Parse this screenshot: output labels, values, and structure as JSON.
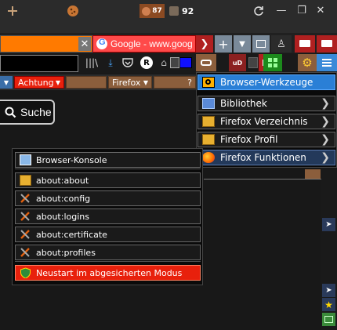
{
  "titlebar": {
    "counter_a": "87",
    "counter_b": "92",
    "icons": [
      "plus-icon",
      "cookie-icon",
      "monkey-icon",
      "puzzle-icon",
      "refresh-icon"
    ]
  },
  "window_controls": {
    "minimize": "—",
    "restore": "❐",
    "close": "✕"
  },
  "tabs": [
    {
      "label": ""
    },
    {
      "label": "Google - www.goog"
    }
  ],
  "tab_close": "✕",
  "bookmarks": [
    {
      "label": "Achtung"
    },
    {
      "label": "Firefox"
    },
    {
      "label": "?"
    }
  ],
  "search_button": {
    "label": "Suche"
  },
  "main_menu": {
    "header": "Browser-Werkzeuge",
    "items": [
      {
        "label": "Bibliothek",
        "arrow": "❯"
      },
      {
        "label": "Firefox Verzeichnis",
        "arrow": "❯"
      },
      {
        "label": "Firefox Profil",
        "arrow": "❯"
      },
      {
        "label": "Firefox Funktionen",
        "arrow": "❯"
      }
    ]
  },
  "submenu": {
    "items": [
      {
        "label": "Browser-Konsole"
      },
      {
        "label": "about:about"
      },
      {
        "label": "about:config"
      },
      {
        "label": "about:logins"
      },
      {
        "label": "about:certificate"
      },
      {
        "label": "about:profiles"
      },
      {
        "label": "Neustart im abgesicherten Modus"
      }
    ]
  },
  "colors": {
    "accent_blue": "#2a7fd6",
    "bookmark_brown": "#8b5e3c",
    "restart_red": "#e8200c",
    "tab_orange": "#ff7a00",
    "tab_red": "#ff4a4a"
  }
}
